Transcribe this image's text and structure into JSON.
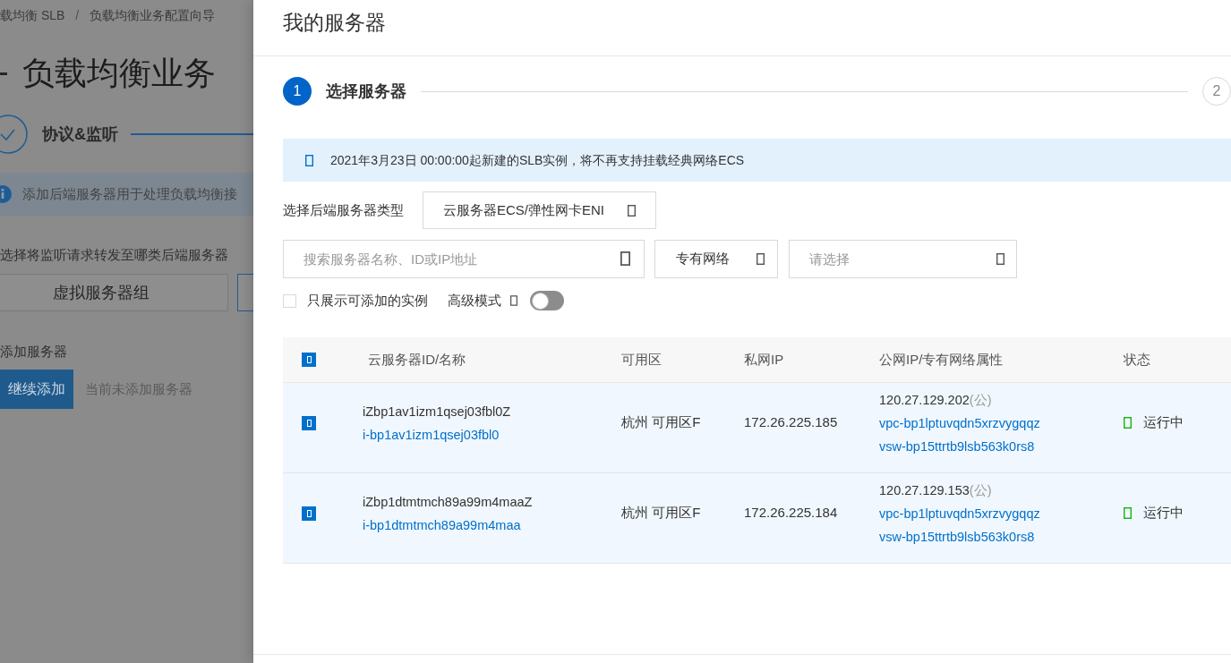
{
  "background_page": {
    "breadcrumb": {
      "items": [
        "载均衡 SLB",
        "负载均衡业务配置向导"
      ],
      "separator": "/"
    },
    "title": "负载均衡业务",
    "step": {
      "label": "协议&监听",
      "done": true
    },
    "alert": "添加后端服务器用于处理负载均衡接",
    "forward_label": "选择将监听请求转发至哪类后端服务器",
    "server_type_options": [
      {
        "label": "虚拟服务器组",
        "selected": false
      },
      {
        "selected": true
      }
    ],
    "add_section_label": "添加服务器",
    "continue_button": "继续添加",
    "empty_hint": "当前未添加服务器"
  },
  "drawer": {
    "title": "我的服务器",
    "steps": [
      {
        "number": "1",
        "label": "选择服务器",
        "selected": true
      },
      {
        "number": "2",
        "selected": false
      }
    ],
    "notice": "2021年3月23日 00:00:00起新建的SLB实例，将不再支持挂载经典网络ECS",
    "server_type": {
      "label": "选择后端服务器类型",
      "value": "云服务器ECS/弹性网卡ENI"
    },
    "search": {
      "placeholder": "搜索服务器名称、ID或IP地址"
    },
    "network_select": {
      "value": "专有网络"
    },
    "vpc_select": {
      "placeholder": "请选择"
    },
    "only_addable": {
      "label": "只展示可添加的实例",
      "checked": false
    },
    "advanced_mode": {
      "label": "高级模式",
      "on": false
    },
    "table": {
      "all_checked": true,
      "columns": [
        "云服务器ID/名称",
        "可用区",
        "私网IP",
        "公网IP/专有网络属性",
        "状态"
      ],
      "rows": [
        {
          "checked": true,
          "name": "iZbp1av1izm1qsej03fbl0Z",
          "id": "i-bp1av1izm1qsej03fbl0",
          "zone": "杭州 可用区F",
          "private_ip": "172.26.225.185",
          "public_ip": "120.27.129.202",
          "public_tag": "(公)",
          "vpc": "vpc-bp1lptuvqdn5xrzvygqqz",
          "vswitch": "vsw-bp15ttrtb9lsb563k0rs8",
          "status": {
            "text": "运行中",
            "color": "#14b514"
          }
        },
        {
          "checked": true,
          "name": "iZbp1dtmtmch89a99m4maaZ",
          "id": "i-bp1dtmtmch89a99m4maa",
          "zone": "杭州 可用区F",
          "private_ip": "172.26.225.184",
          "public_ip": "120.27.129.153",
          "public_tag": "(公)",
          "vpc": "vpc-bp1lptuvqdn5xrzvygqqz",
          "vswitch": "vsw-bp15ttrtb9lsb563k0rs8",
          "status": {
            "text": "运行中",
            "color": "#14b514"
          }
        }
      ]
    }
  }
}
